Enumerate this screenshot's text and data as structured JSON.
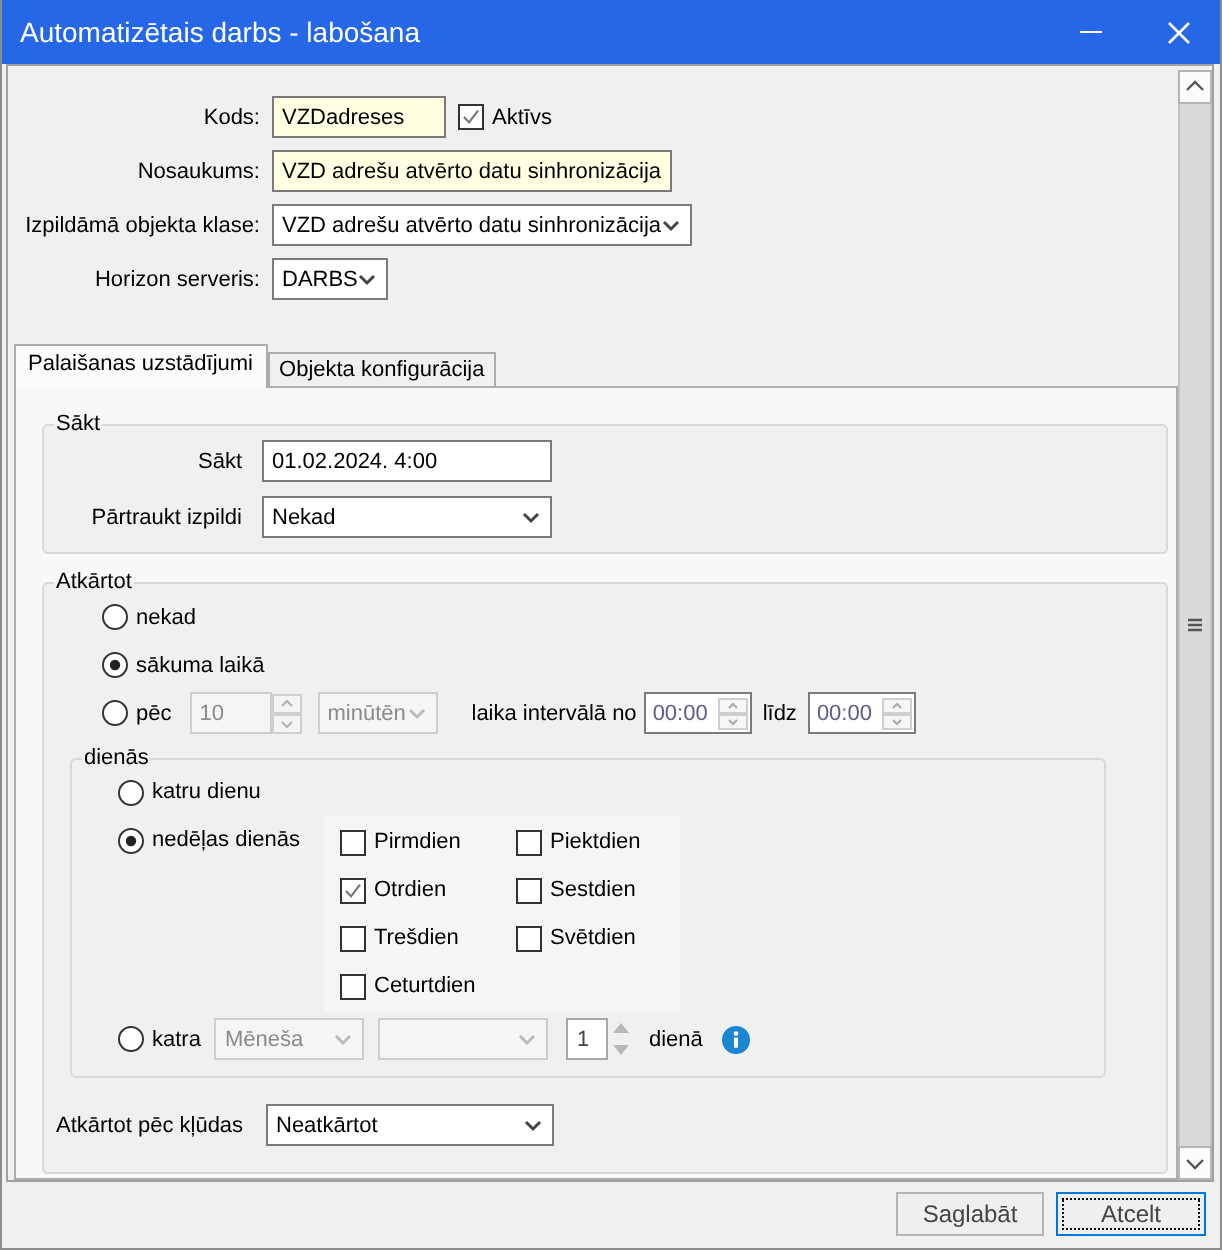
{
  "window": {
    "title": "Automatizētais darbs - labošana"
  },
  "fields": [
    {
      "label": "Kods:",
      "value": "VZDadreses",
      "kind": "text",
      "highlighted": true,
      "checkbox": {
        "label": "Aktīvs",
        "checked": true
      }
    },
    {
      "label": "Nosaukums:",
      "value": "VZD adrešu atvērto datu sinhronizācija",
      "kind": "text",
      "highlighted": true
    },
    {
      "label": "Izpildāmā objekta klase:",
      "value": "VZD adrešu atvērto datu sinhronizācija",
      "kind": "dropdown",
      "highlighted": false
    },
    {
      "label": "Horizon serveris:",
      "value": "DARBS",
      "kind": "dropdown",
      "highlighted": false
    }
  ],
  "tabs": [
    {
      "label": "Palaišanas uzstādījumi",
      "selected": true
    },
    {
      "label": "Objekta konfigurācija",
      "selected": false
    }
  ],
  "start": {
    "legend": "Sākt",
    "fields": [
      {
        "label": "Sākt",
        "value": "01.02.2024. 4:00",
        "kind": "text"
      },
      {
        "label": "Pārtraukt izpildi",
        "value": "Nekad",
        "kind": "dropdown"
      }
    ]
  },
  "repeat": {
    "legend": "Atkārtot",
    "options": [
      {
        "label": "nekad",
        "selected": false
      },
      {
        "label": "sākuma laikā",
        "selected": true
      },
      {
        "label": "pēc",
        "selected": false,
        "interval": {
          "value": "10",
          "unit": "minūtēn",
          "disabled": true,
          "from_label": "laika intervālā no",
          "from": "00:00",
          "to_label": "līdz",
          "to": "00:00"
        }
      }
    ],
    "days": {
      "legend": "dienās",
      "options": [
        {
          "label": "katru dienu",
          "selected": false
        },
        {
          "label": "nedēļas dienās",
          "selected": true,
          "weekdays": [
            {
              "label": "Pirmdien",
              "checked": false
            },
            {
              "label": "Otrdien",
              "checked": true
            },
            {
              "label": "Trešdien",
              "checked": false
            },
            {
              "label": "Ceturtdien",
              "checked": false
            },
            {
              "label": "Piektdien",
              "checked": false
            },
            {
              "label": "Sestdien",
              "checked": false
            },
            {
              "label": "Svētdien",
              "checked": false
            }
          ]
        },
        {
          "label": "katra",
          "selected": false,
          "monthly": {
            "period": "Mēneša",
            "day": "1",
            "suffix": "dienā",
            "disabled": true
          }
        }
      ]
    },
    "retry": {
      "label": "Atkārtot pēc kļūdas",
      "value": "Neatkārtot"
    }
  },
  "buttons": [
    {
      "label": "Saglabāt",
      "focused": false
    },
    {
      "label": "Atcelt",
      "focused": true
    }
  ]
}
